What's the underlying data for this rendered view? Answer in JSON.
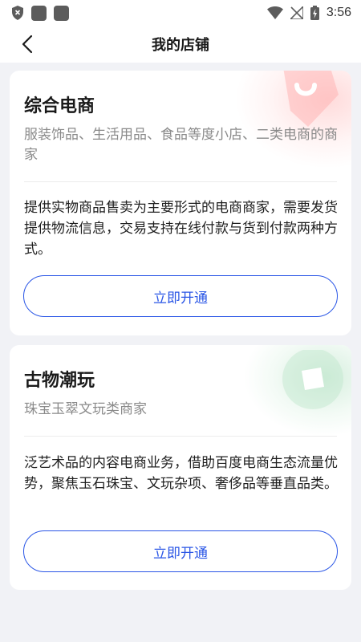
{
  "status_bar": {
    "time": "3:56",
    "icons": [
      "shield-x-icon",
      "app-icon",
      "app-icon",
      "wifi-icon",
      "no-signal-icon",
      "battery-charging-icon"
    ]
  },
  "nav": {
    "back_icon": "chevron-left-icon",
    "title": "我的店铺"
  },
  "cards": [
    {
      "title": "综合电商",
      "subtitle": "服装饰品、生活用品、食品等度小店、二类电商的商家",
      "description": "提供实物商品售卖为主要形式的电商商家，需要发货提供物流信息，交易支持在线付款与货到付款两种方式。",
      "button_label": "立即开通",
      "decoration_icon": "shopping-bag-icon",
      "accent_color": "#ffb3b3"
    },
    {
      "title": "古物潮玩",
      "subtitle": "珠宝玉翠文玩类商家",
      "description": "泛艺术品的内容电商业务，借助百度电商生态流量优势，聚焦玉石珠宝、文玩杂项、奢侈品等垂直品类。",
      "button_label": "立即开通",
      "decoration_icon": "gem-icon",
      "accent_color": "#bfe6cc"
    }
  ],
  "colors": {
    "primary": "#2a56e6",
    "background": "#f1f2f6",
    "card": "#ffffff"
  }
}
